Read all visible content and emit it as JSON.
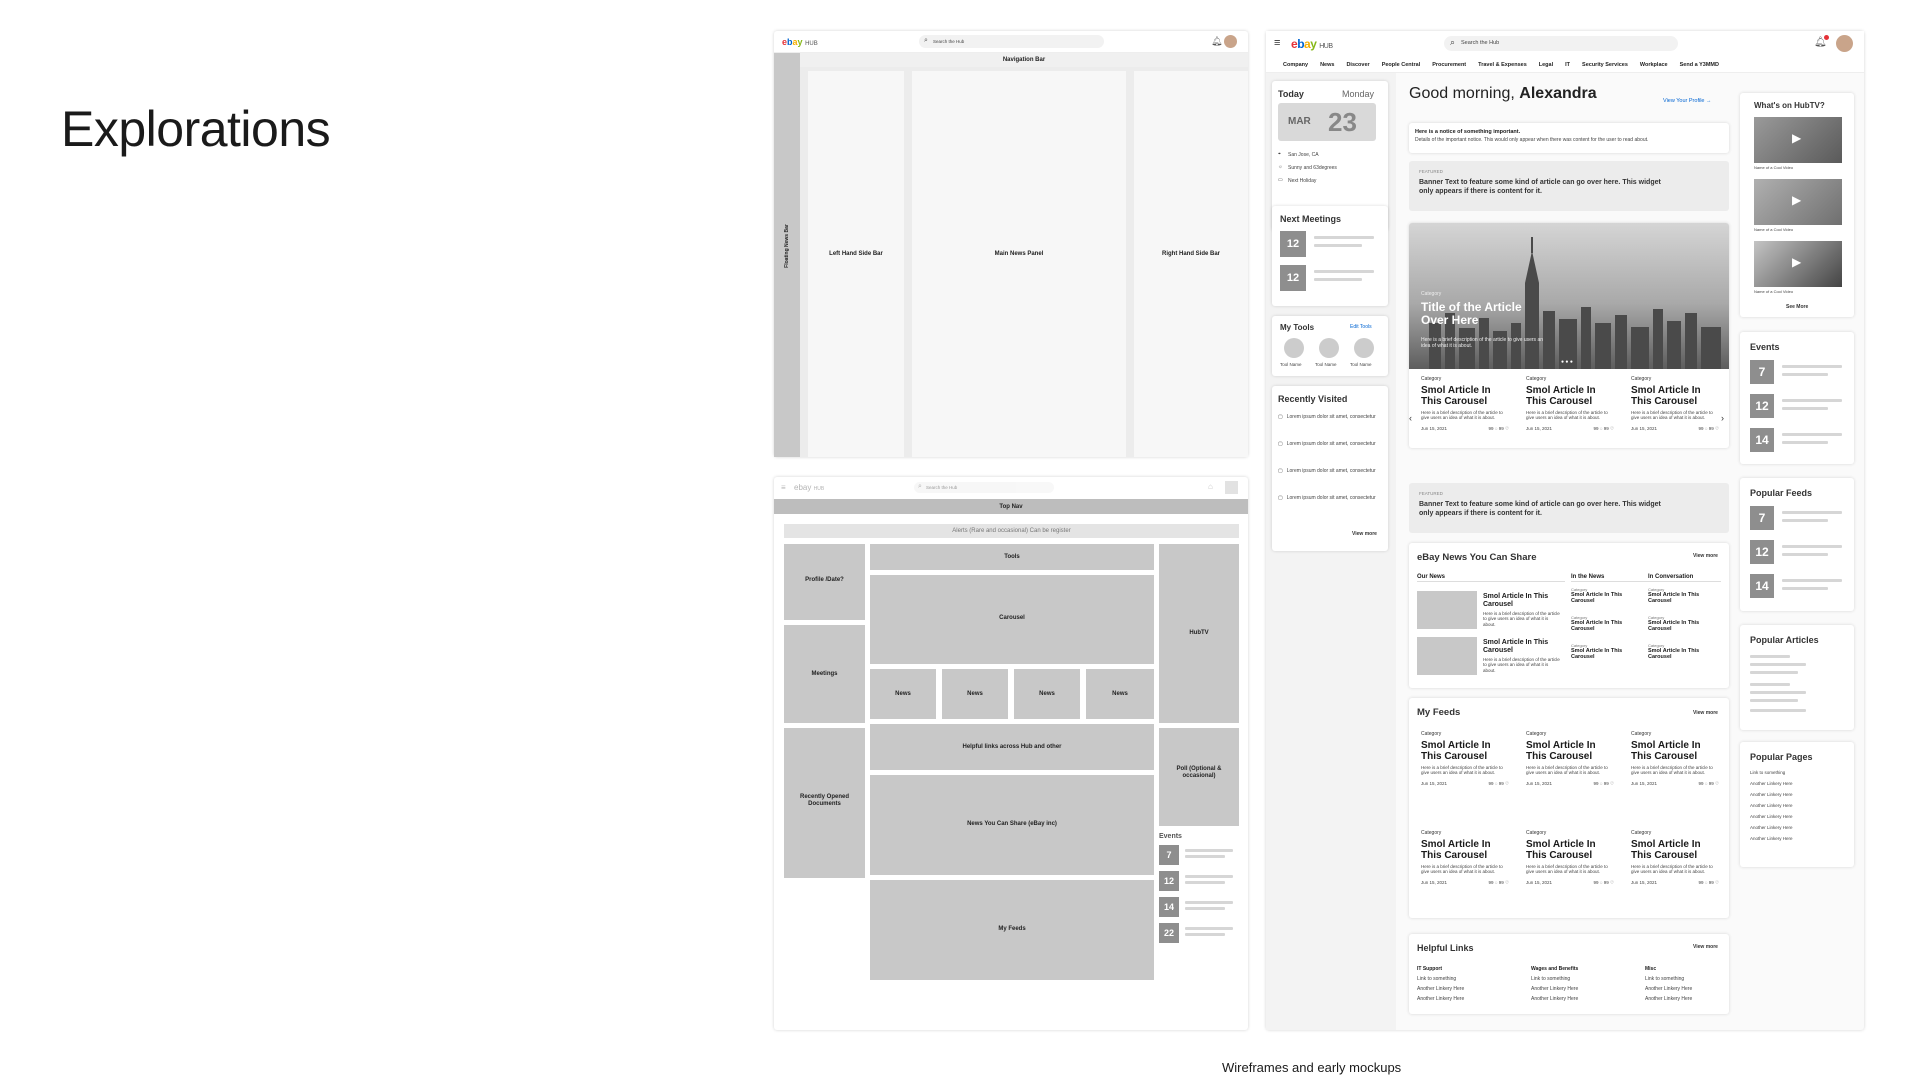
{
  "slide_title": "Explorations",
  "caption": "Wireframes and early mockups",
  "colors": {
    "ebay_red": "#e53238",
    "ebay_blue": "#0064d2",
    "ebay_yellow": "#f5af02",
    "ebay_green": "#86b817",
    "placeholder": "#c8c8c8"
  },
  "wf1": {
    "logo": "ebay",
    "hub": "HUB",
    "search": "Search the Hub",
    "nav_bar": "Navigation Bar",
    "floating": "Floating News Bar",
    "left": "Left Hand Side Bar",
    "main": "Main News Panel",
    "right": "Right Hand Side Bar"
  },
  "wf2": {
    "logo": "ebay",
    "hub": "HUB",
    "search": "Search the Hub",
    "top_nav": "Top Nav",
    "alerts": "Alerts (Rare and occasional) Can be register",
    "profile": "Profile /Date?",
    "meetings": "Meetings",
    "recent_docs": "Recently Opened Documents",
    "tools": "Tools",
    "carousel": "Carousel",
    "news": [
      "News",
      "News",
      "News",
      "News"
    ],
    "helpful": "Helpful links across Hub and other",
    "nycs": "News You Can Share (eBay inc)",
    "feeds": "My Feeds",
    "hubtv": "HubTV",
    "poll": "Poll (Optional & occasional)",
    "events_label": "Events",
    "events": [
      "7",
      "12",
      "14",
      "22"
    ]
  },
  "mock": {
    "logo": "ebay",
    "hub": "HUB",
    "search": "Search the Hub",
    "nav": [
      "Company",
      "News",
      "Discover",
      "People Central",
      "Procurement",
      "Travel & Expenses",
      "Legal",
      "IT",
      "Security Services",
      "Workplace",
      "Send a Y3MMD"
    ],
    "today": "Today",
    "weekday": "Monday",
    "month": "MAR",
    "day": "23",
    "location": "San Jose, CA",
    "weather": "Sunny and 63degrees",
    "holiday": "Next Holiday",
    "meetings_title": "Next Meetings",
    "meetings": [
      "12",
      "12"
    ],
    "tools_title": "My Tools",
    "edit_tools": "Edit Tools",
    "tools": [
      "Tool Name",
      "Tool Name",
      "Tool Name"
    ],
    "recent_title": "Recently Visited",
    "recent": [
      "Lorem ipsum dolor sit amet, consectetur",
      "Lorem ipsum dolor sit amet, consectetur",
      "Lorem ipsum dolor sit amet, consectetur",
      "Lorem ipsum dolor sit amet, consectetur"
    ],
    "view_more": "View more",
    "greeting": "Good morning,",
    "name": "Alexandra",
    "view_profile": "View Your Profile",
    "notice_title": "Here is a notice of something important.",
    "notice_body": "Details of the important notice. This would only appear when there was content for the user to read about.",
    "featured": "FEATURED",
    "banner": "Banner Text to feature some kind of article can go over here. This widget only appears if there is content for it.",
    "hero_cat": "Category",
    "hero_title": "Title of the Article Over Here",
    "hero_desc": "Here is a brief description of the article to give users an idea of what it is about.",
    "article": {
      "cat": "Category",
      "title": "Smol Article In This Carousel",
      "desc": "Here is a brief description of the article to give users an idea of what it is about.",
      "date": "Jun 15, 2021",
      "likes": "99",
      "comments": "99"
    },
    "share_title": "eBay News You Can Share",
    "share_cols": [
      "Our News",
      "In the News",
      "In Conversation"
    ],
    "share_small": "Smol Article In This Carousel",
    "share_cat": "Category",
    "feeds_title": "My Feeds",
    "links_title": "Helpful Links",
    "link_cols": [
      {
        "h": "IT Support",
        "items": [
          "Link to something",
          "Another Linkery Here",
          "Another Linkery Here"
        ]
      },
      {
        "h": "Wages and Benefits",
        "items": [
          "Link to something",
          "Another Linkery Here",
          "Another Linkery Here"
        ]
      },
      {
        "h": "Misc",
        "items": [
          "Link to something",
          "Another Linkery Here",
          "Another Linkery Here"
        ]
      }
    ],
    "hubtv_title": "What's on HubTV?",
    "video_label": "Name of a Cool Video",
    "see_more": "See More",
    "events_title": "Events",
    "events": [
      "7",
      "12",
      "14"
    ],
    "popular_feeds": "Popular Feeds",
    "popular_feeds_nums": [
      "7",
      "12",
      "14"
    ],
    "popular_articles": "Popular Articles",
    "popular_pages": "Popular Pages",
    "pages": [
      "Link to something",
      "Another Linkery Here",
      "Another Linkery Here",
      "Another Linkery Here",
      "Another Linkery Here",
      "Another Linkery Here",
      "Another Linkery Here"
    ]
  }
}
